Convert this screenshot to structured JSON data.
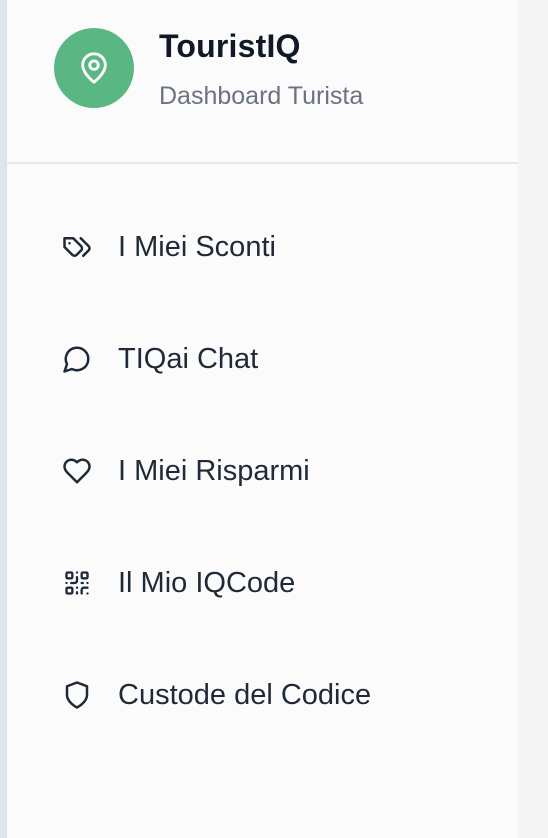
{
  "brand": {
    "title": "TouristIQ",
    "subtitle": "Dashboard Turista",
    "logo_icon": "map-pin-icon",
    "accent_color": "#5ab783"
  },
  "nav": {
    "items": [
      {
        "label": "I Miei Sconti",
        "icon": "tags-icon"
      },
      {
        "label": "TIQai Chat",
        "icon": "message-circle-icon"
      },
      {
        "label": "I Miei Risparmi",
        "icon": "heart-icon"
      },
      {
        "label": "Il Mio IQCode",
        "icon": "qr-code-icon"
      },
      {
        "label": "Custode del Codice",
        "icon": "shield-icon"
      }
    ]
  }
}
